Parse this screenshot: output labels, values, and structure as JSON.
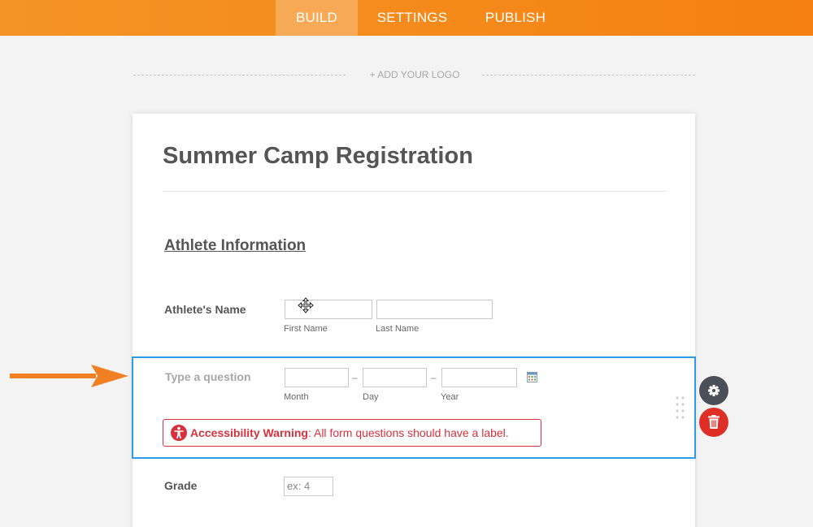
{
  "nav": {
    "tabs": [
      {
        "label": "BUILD",
        "active": true
      },
      {
        "label": "SETTINGS",
        "active": false
      },
      {
        "label": "PUBLISH",
        "active": false
      }
    ]
  },
  "logo": {
    "add_label": "+ ADD YOUR LOGO"
  },
  "form": {
    "title": "Summer Camp Registration",
    "section_title": "Athlete Information",
    "name_question": {
      "label": "Athlete's Name",
      "first_sublabel": "First Name",
      "last_sublabel": "Last Name"
    },
    "date_question": {
      "label_placeholder": "Type a question",
      "separator": "–",
      "month_sublabel": "Month",
      "day_sublabel": "Day",
      "year_sublabel": "Year",
      "warning_title": "Accessibility Warning",
      "warning_message": ": All form questions should have a label."
    },
    "grade_question": {
      "label": "Grade",
      "placeholder": "ex: 4"
    }
  },
  "colors": {
    "topbar": "#f58a1b",
    "selected_border": "#2e9be6",
    "warning": "#d6313c",
    "gear_button": "#4b5058",
    "delete_button": "#de2f27",
    "arrow": "#f08021"
  },
  "icons": [
    "move-cursor-icon",
    "calendar-icon",
    "accessibility-icon",
    "gear-icon",
    "trash-icon",
    "drag-handle-icon",
    "pointer-arrow-icon"
  ]
}
